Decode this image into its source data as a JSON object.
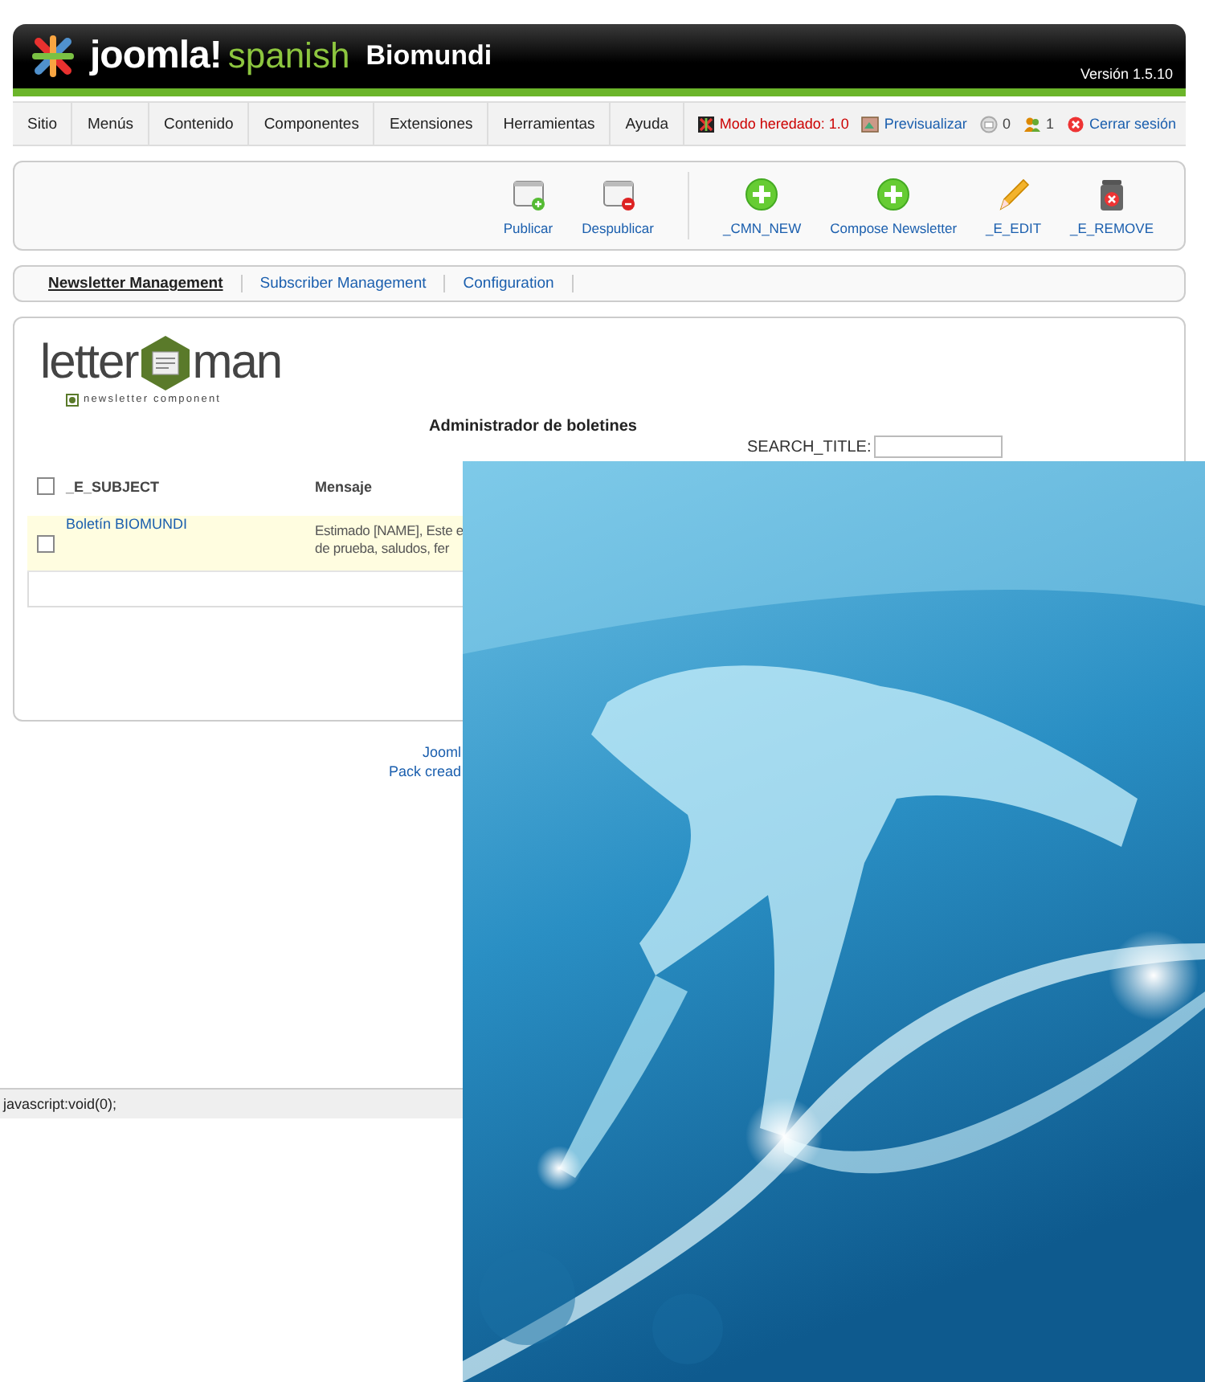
{
  "header": {
    "brand": "joomla!",
    "brand_suffix": "spanish",
    "site": "Biomundi",
    "version": "Versión 1.5.10"
  },
  "menu": [
    {
      "label": "Sitio"
    },
    {
      "label": "Menús"
    },
    {
      "label": "Contenido"
    },
    {
      "label": "Componentes"
    },
    {
      "label": "Extensiones"
    },
    {
      "label": "Herramientas"
    },
    {
      "label": "Ayuda"
    }
  ],
  "status_links": [
    {
      "kind": "legacy",
      "label": "Modo heredado: 1.0"
    },
    {
      "kind": "preview",
      "label": "Previsualizar"
    },
    {
      "kind": "messages",
      "label": "0"
    },
    {
      "kind": "users",
      "label": "1"
    },
    {
      "kind": "logout",
      "label": "Cerrar sesión"
    }
  ],
  "toolbar": [
    {
      "kind": "publish",
      "label": "Publicar"
    },
    {
      "kind": "unpublish",
      "label": "Despublicar"
    },
    {
      "kind": "new",
      "label": "_CMN_NEW"
    },
    {
      "kind": "new",
      "label": "Compose Newsletter"
    },
    {
      "kind": "edit",
      "label": "_E_EDIT"
    },
    {
      "kind": "remove",
      "label": "_E_REMOVE"
    }
  ],
  "submenu": [
    {
      "label": "Newsletter Management",
      "selected": true
    },
    {
      "label": "Subscriber Management",
      "selected": false
    },
    {
      "label": "Configuration",
      "selected": false
    }
  ],
  "logo": {
    "left": "letter",
    "right": "man",
    "tagline": "newsletter component"
  },
  "heading": "Administrador de boletines",
  "search": {
    "label": "SEARCH_TITLE:"
  },
  "table": {
    "columns": [
      "_E_SUBJECT",
      "Mensaje"
    ],
    "header_checked": false,
    "rows": [
      {
        "checked": false,
        "subject": "Boletín BIOMUNDI",
        "message_lines": [
          "Estimado [NAME], Este e",
          "de prueba, saludos, fer"
        ]
      }
    ]
  },
  "footer": [
    "Jooml",
    "Pack cread"
  ],
  "status_bar": "javascript:void(0);",
  "overlay": {
    "kind": "picture"
  }
}
